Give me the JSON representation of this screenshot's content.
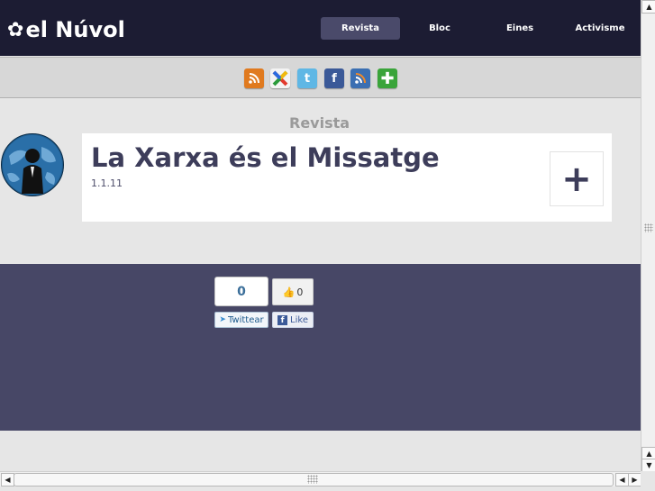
{
  "header": {
    "logo_text": "el Núvol",
    "nav": [
      {
        "label": "Revista",
        "active": true
      },
      {
        "label": "Bloc",
        "active": false
      },
      {
        "label": "Eines",
        "active": false
      },
      {
        "label": "Activisme",
        "active": false
      }
    ]
  },
  "social_icons": [
    "rss-icon",
    "google-buzz-icon",
    "twitter-icon",
    "facebook-icon",
    "rss-feed-icon",
    "add-icon"
  ],
  "section": {
    "title": "Revista"
  },
  "post": {
    "title": "La Xarxa és el Missatge",
    "date": "1.1.11",
    "expand_symbol": "+"
  },
  "share": {
    "twitter_count": "0",
    "twitter_label": "Twittear",
    "facebook_count": "0",
    "facebook_label": "Like"
  },
  "colors": {
    "header_bg": "#1c1c33",
    "nav_active_bg": "#4a4a6a",
    "band_bg": "#474766",
    "title_color": "#3d3d5a"
  }
}
